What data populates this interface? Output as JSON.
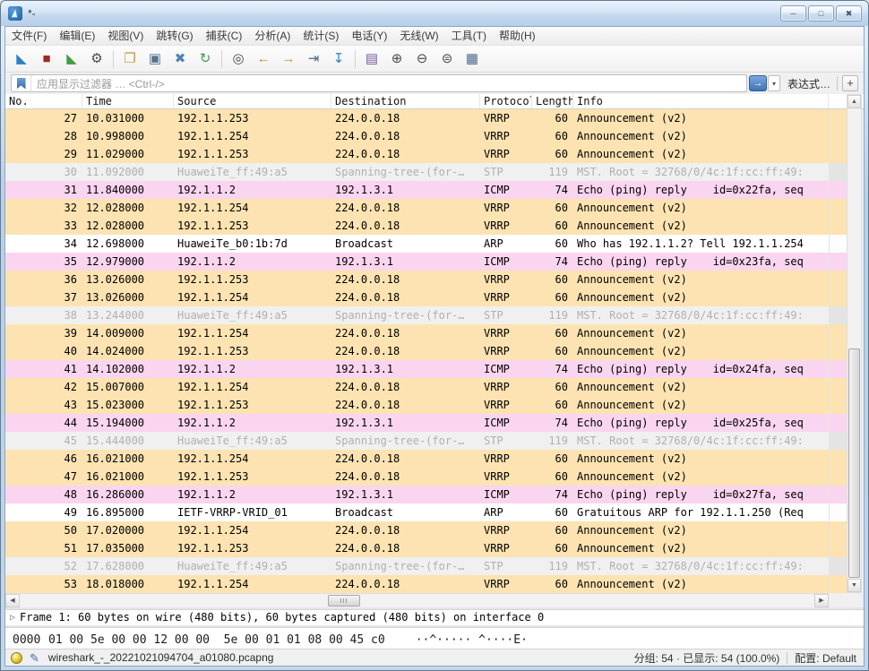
{
  "colors": {
    "accent_blue": "#2f7fc1",
    "row_vrrp": "#fce3b1",
    "row_icmp": "#fad5f0",
    "row_arp": "#ffffff",
    "row_stp_bg": "#f0f0f0",
    "row_stp_text": "#b0b0b0",
    "titlebar_top": "#e9f3fd",
    "titlebar_bottom": "#b7cfe9"
  },
  "window": {
    "title": "*-",
    "controls": {
      "minimize": "─",
      "maximize": "□",
      "close": "✖"
    }
  },
  "menu": {
    "items": [
      {
        "id": "file",
        "label": "文件(F)"
      },
      {
        "id": "edit",
        "label": "编辑(E)"
      },
      {
        "id": "view",
        "label": "视图(V)"
      },
      {
        "id": "go",
        "label": "跳转(G)"
      },
      {
        "id": "capture",
        "label": "捕获(C)"
      },
      {
        "id": "analyze",
        "label": "分析(A)"
      },
      {
        "id": "statistics",
        "label": "统计(S)"
      },
      {
        "id": "telephony",
        "label": "电话(Y)"
      },
      {
        "id": "wireless",
        "label": "无线(W)"
      },
      {
        "id": "tools",
        "label": "工具(T)"
      },
      {
        "id": "help",
        "label": "帮助(H)"
      }
    ]
  },
  "toolbar": {
    "items": [
      {
        "name": "start-capture-icon",
        "glyph": "◣",
        "color": "#2f7fc1"
      },
      {
        "name": "stop-capture-icon",
        "glyph": "■",
        "color": "#9e2b25"
      },
      {
        "name": "restart-capture-icon",
        "glyph": "◣",
        "color": "#3f9e46"
      },
      {
        "name": "capture-options-icon",
        "glyph": "⚙",
        "color": "#4a4a4a"
      },
      {
        "sep": true
      },
      {
        "name": "open-file-icon",
        "glyph": "❐",
        "color": "#c79532"
      },
      {
        "name": "save-file-icon",
        "glyph": "▣",
        "color": "#58718e"
      },
      {
        "name": "close-file-icon",
        "glyph": "✖",
        "color": "#4f81b8"
      },
      {
        "name": "reload-icon",
        "glyph": "↻",
        "color": "#3f9e46"
      },
      {
        "sep": true
      },
      {
        "name": "find-packet-icon",
        "glyph": "◎",
        "color": "#4a4a4a"
      },
      {
        "name": "go-back-icon",
        "glyph": "←",
        "color": "#c79532"
      },
      {
        "name": "go-forward-icon",
        "glyph": "→",
        "color": "#c79532"
      },
      {
        "name": "go-to-packet-icon",
        "glyph": "⇥",
        "color": "#4a6a8a"
      },
      {
        "name": "auto-scroll-icon",
        "glyph": "↧",
        "color": "#2f7fc1"
      },
      {
        "sep": true
      },
      {
        "name": "colorize-icon",
        "glyph": "▤",
        "color": "#7a5aa0"
      },
      {
        "name": "zoom-in-icon",
        "glyph": "⊕",
        "color": "#4a4a4a"
      },
      {
        "name": "zoom-out-icon",
        "glyph": "⊖",
        "color": "#4a4a4a"
      },
      {
        "name": "zoom-reset-icon",
        "glyph": "⊜",
        "color": "#4a4a4a"
      },
      {
        "name": "resize-columns-icon",
        "glyph": "▦",
        "color": "#4a6a8a"
      }
    ]
  },
  "filter": {
    "placeholder": "应用显示过滤器 … <Ctrl-/>",
    "apply_glyph": "→",
    "caret_glyph": "▾",
    "expression_label": "表达式…",
    "add_label": "+"
  },
  "icons": {
    "up": "▲",
    "down": "▼",
    "left": "◀",
    "right": "▶"
  },
  "table": {
    "columns": [
      {
        "key": "no",
        "label": "No."
      },
      {
        "key": "time",
        "label": "Time"
      },
      {
        "key": "source",
        "label": "Source"
      },
      {
        "key": "destination",
        "label": "Destination"
      },
      {
        "key": "protocol",
        "label": "Protocol"
      },
      {
        "key": "length",
        "label": "Length"
      },
      {
        "key": "info",
        "label": "Info"
      }
    ],
    "rows": [
      {
        "no": "27",
        "time": "10.031000",
        "source": "192.1.1.253",
        "destination": "224.0.0.18",
        "protocol": "VRRP",
        "length": "60",
        "info": "Announcement (v2)",
        "type": "vrrp"
      },
      {
        "no": "28",
        "time": "10.998000",
        "source": "192.1.1.254",
        "destination": "224.0.0.18",
        "protocol": "VRRP",
        "length": "60",
        "info": "Announcement (v2)",
        "type": "vrrp"
      },
      {
        "no": "29",
        "time": "11.029000",
        "source": "192.1.1.253",
        "destination": "224.0.0.18",
        "protocol": "VRRP",
        "length": "60",
        "info": "Announcement (v2)",
        "type": "vrrp"
      },
      {
        "no": "30",
        "time": "11.092000",
        "source": "HuaweiTe_ff:49:a5",
        "destination": "Spanning-tree-(for-…",
        "protocol": "STP",
        "length": "119",
        "info": "MST. Root = 32768/0/4c:1f:cc:ff:49:",
        "type": "stp"
      },
      {
        "no": "31",
        "time": "11.840000",
        "source": "192.1.1.2",
        "destination": "192.1.3.1",
        "protocol": "ICMP",
        "length": "74",
        "info": "Echo (ping) reply    id=0x22fa, seq",
        "type": "icmp"
      },
      {
        "no": "32",
        "time": "12.028000",
        "source": "192.1.1.254",
        "destination": "224.0.0.18",
        "protocol": "VRRP",
        "length": "60",
        "info": "Announcement (v2)",
        "type": "vrrp"
      },
      {
        "no": "33",
        "time": "12.028000",
        "source": "192.1.1.253",
        "destination": "224.0.0.18",
        "protocol": "VRRP",
        "length": "60",
        "info": "Announcement (v2)",
        "type": "vrrp"
      },
      {
        "no": "34",
        "time": "12.698000",
        "source": "HuaweiTe_b0:1b:7d",
        "destination": "Broadcast",
        "protocol": "ARP",
        "length": "60",
        "info": "Who has 192.1.1.2? Tell 192.1.1.254",
        "type": "arp"
      },
      {
        "no": "35",
        "time": "12.979000",
        "source": "192.1.1.2",
        "destination": "192.1.3.1",
        "protocol": "ICMP",
        "length": "74",
        "info": "Echo (ping) reply    id=0x23fa, seq",
        "type": "icmp"
      },
      {
        "no": "36",
        "time": "13.026000",
        "source": "192.1.1.253",
        "destination": "224.0.0.18",
        "protocol": "VRRP",
        "length": "60",
        "info": "Announcement (v2)",
        "type": "vrrp"
      },
      {
        "no": "37",
        "time": "13.026000",
        "source": "192.1.1.254",
        "destination": "224.0.0.18",
        "protocol": "VRRP",
        "length": "60",
        "info": "Announcement (v2)",
        "type": "vrrp"
      },
      {
        "no": "38",
        "time": "13.244000",
        "source": "HuaweiTe_ff:49:a5",
        "destination": "Spanning-tree-(for-…",
        "protocol": "STP",
        "length": "119",
        "info": "MST. Root = 32768/0/4c:1f:cc:ff:49:",
        "type": "stp"
      },
      {
        "no": "39",
        "time": "14.009000",
        "source": "192.1.1.254",
        "destination": "224.0.0.18",
        "protocol": "VRRP",
        "length": "60",
        "info": "Announcement (v2)",
        "type": "vrrp"
      },
      {
        "no": "40",
        "time": "14.024000",
        "source": "192.1.1.253",
        "destination": "224.0.0.18",
        "protocol": "VRRP",
        "length": "60",
        "info": "Announcement (v2)",
        "type": "vrrp"
      },
      {
        "no": "41",
        "time": "14.102000",
        "source": "192.1.1.2",
        "destination": "192.1.3.1",
        "protocol": "ICMP",
        "length": "74",
        "info": "Echo (ping) reply    id=0x24fa, seq",
        "type": "icmp"
      },
      {
        "no": "42",
        "time": "15.007000",
        "source": "192.1.1.254",
        "destination": "224.0.0.18",
        "protocol": "VRRP",
        "length": "60",
        "info": "Announcement (v2)",
        "type": "vrrp"
      },
      {
        "no": "43",
        "time": "15.023000",
        "source": "192.1.1.253",
        "destination": "224.0.0.18",
        "protocol": "VRRP",
        "length": "60",
        "info": "Announcement (v2)",
        "type": "vrrp"
      },
      {
        "no": "44",
        "time": "15.194000",
        "source": "192.1.1.2",
        "destination": "192.1.3.1",
        "protocol": "ICMP",
        "length": "74",
        "info": "Echo (ping) reply    id=0x25fa, seq",
        "type": "icmp"
      },
      {
        "no": "45",
        "time": "15.444000",
        "source": "HuaweiTe_ff:49:a5",
        "destination": "Spanning-tree-(for-…",
        "protocol": "STP",
        "length": "119",
        "info": "MST. Root = 32768/0/4c:1f:cc:ff:49:",
        "type": "stp"
      },
      {
        "no": "46",
        "time": "16.021000",
        "source": "192.1.1.254",
        "destination": "224.0.0.18",
        "protocol": "VRRP",
        "length": "60",
        "info": "Announcement (v2)",
        "type": "vrrp"
      },
      {
        "no": "47",
        "time": "16.021000",
        "source": "192.1.1.253",
        "destination": "224.0.0.18",
        "protocol": "VRRP",
        "length": "60",
        "info": "Announcement (v2)",
        "type": "vrrp"
      },
      {
        "no": "48",
        "time": "16.286000",
        "source": "192.1.1.2",
        "destination": "192.1.3.1",
        "protocol": "ICMP",
        "length": "74",
        "info": "Echo (ping) reply    id=0x27fa, seq",
        "type": "icmp"
      },
      {
        "no": "49",
        "time": "16.895000",
        "source": "IETF-VRRP-VRID_01",
        "destination": "Broadcast",
        "protocol": "ARP",
        "length": "60",
        "info": "Gratuitous ARP for 192.1.1.250 (Req",
        "type": "arp"
      },
      {
        "no": "50",
        "time": "17.020000",
        "source": "192.1.1.254",
        "destination": "224.0.0.18",
        "protocol": "VRRP",
        "length": "60",
        "info": "Announcement (v2)",
        "type": "vrrp"
      },
      {
        "no": "51",
        "time": "17.035000",
        "source": "192.1.1.253",
        "destination": "224.0.0.18",
        "protocol": "VRRP",
        "length": "60",
        "info": "Announcement (v2)",
        "type": "vrrp"
      },
      {
        "no": "52",
        "time": "17.628000",
        "source": "HuaweiTe_ff:49:a5",
        "destination": "Spanning-tree-(for-…",
        "protocol": "STP",
        "length": "119",
        "info": "MST. Root = 32768/0/4c:1f:cc:ff:49:",
        "type": "stp"
      },
      {
        "no": "53",
        "time": "18.018000",
        "source": "192.1.1.254",
        "destination": "224.0.0.18",
        "protocol": "VRRP",
        "length": "60",
        "info": "Announcement (v2)",
        "type": "vrrp"
      }
    ]
  },
  "panes": {
    "expander": "▷",
    "frame_summary": "Frame 1: 60 bytes on wire (480 bits), 60 bytes captured (480 bits) on interface 0"
  },
  "hex": {
    "offset": "0000",
    "bytes": "01 00 5e 00 00 12 00 00  5e 00 01 01 08 00 45 c0",
    "ascii": "··^····· ^····E·"
  },
  "statusbar": {
    "edit_glyph": "✎",
    "filename": "wireshark_-_20221021094704_a01080.pcapng",
    "packets_summary": "分组: 54 · 已显示: 54 (100.0%)",
    "profile": "配置: Default"
  }
}
